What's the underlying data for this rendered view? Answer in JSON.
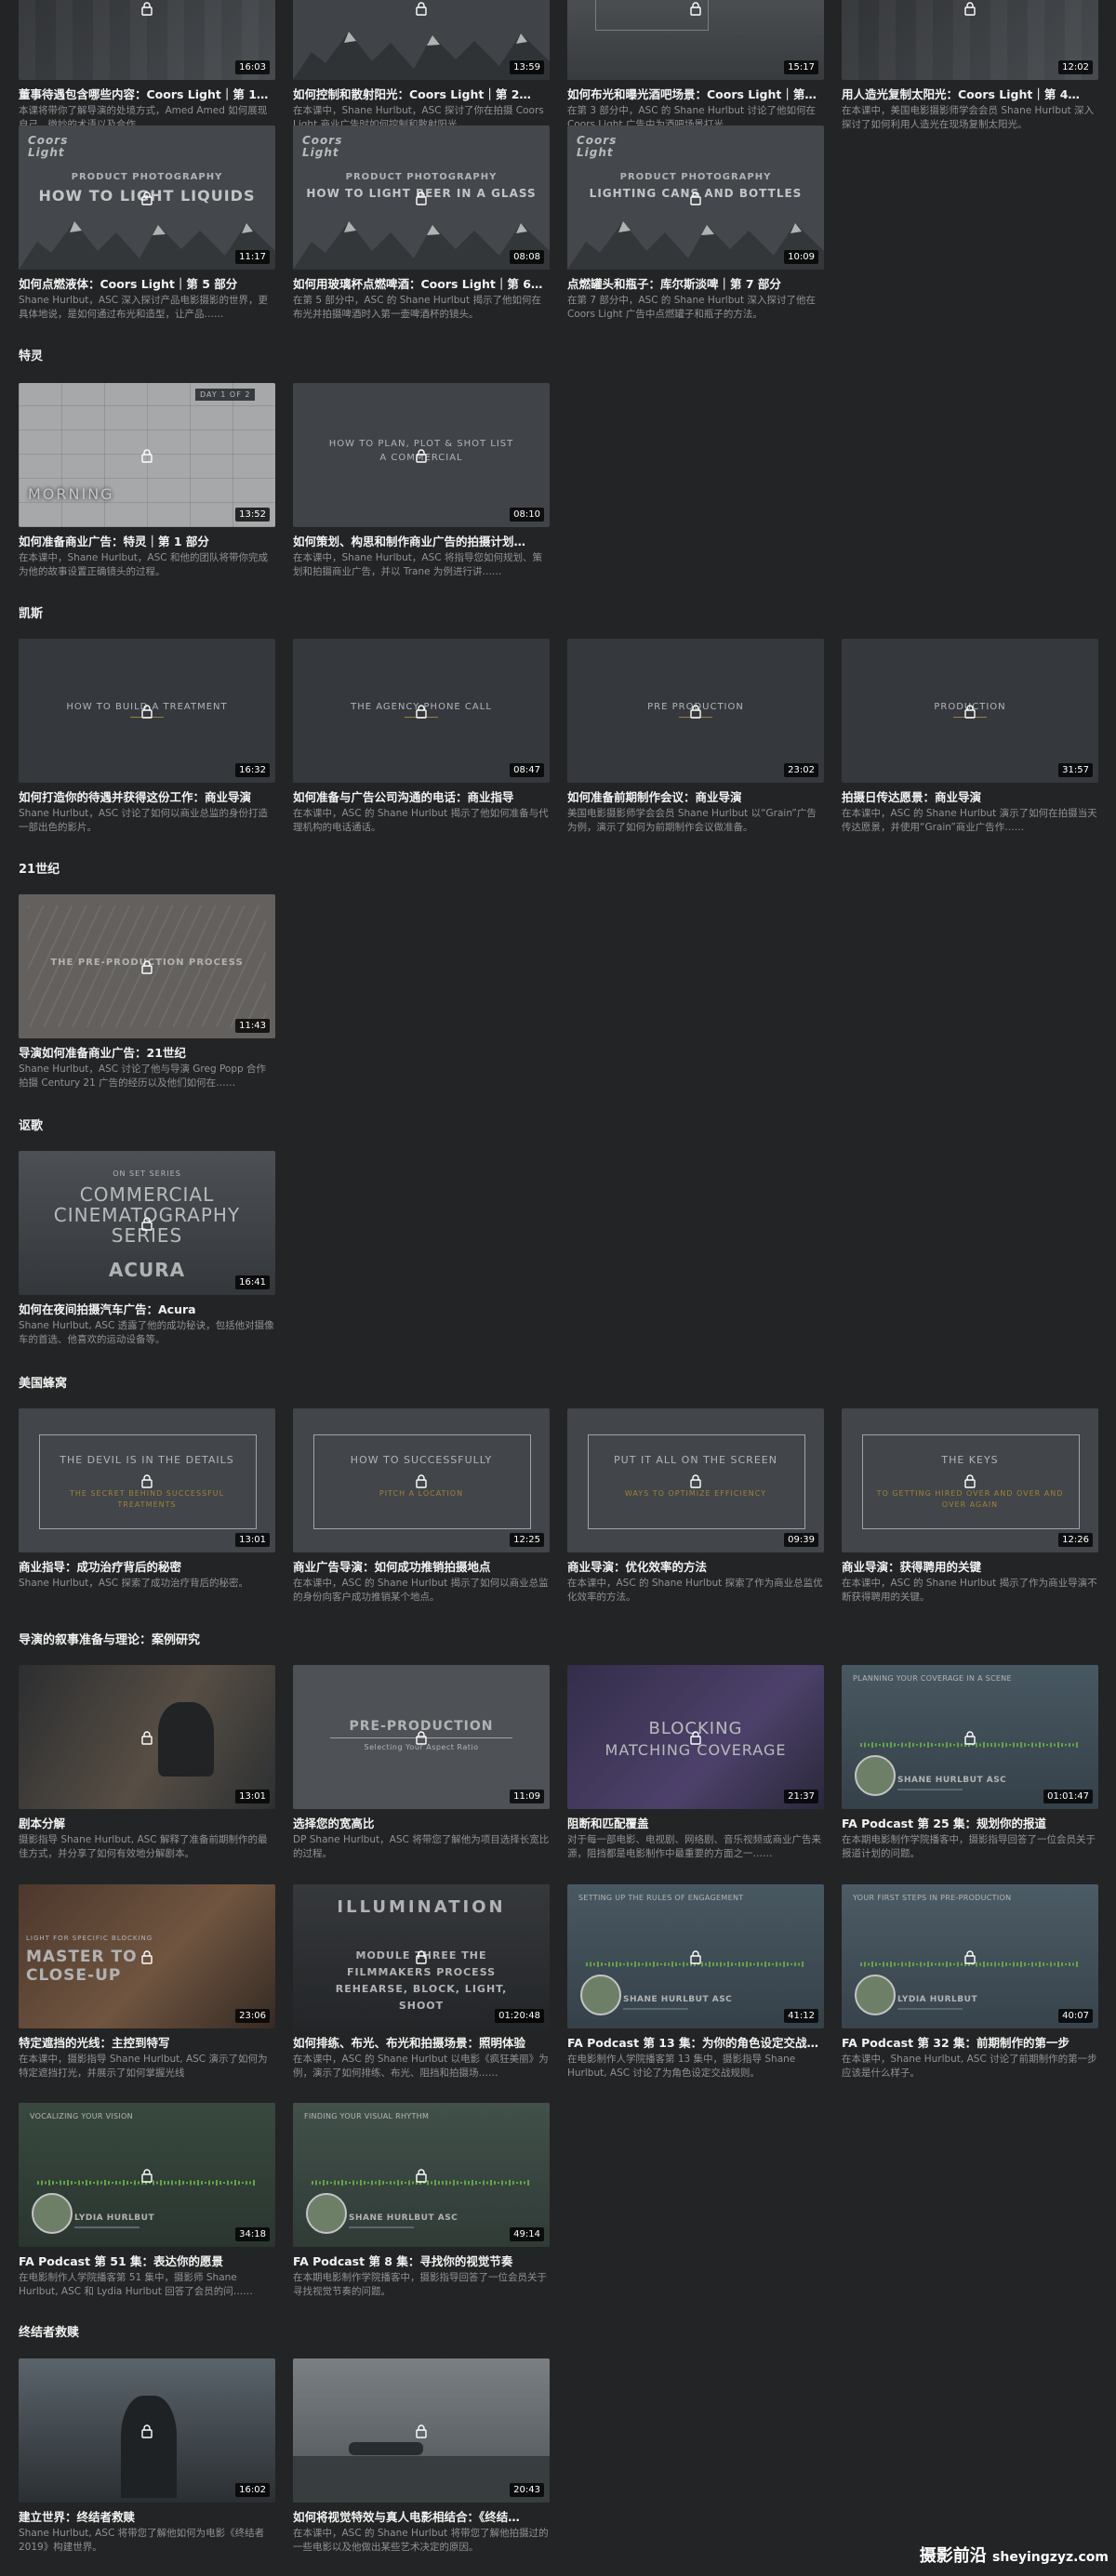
{
  "sections": [
    {
      "title": "",
      "cards": [
        {
          "title": "董事待遇包含哪些内容：Coors Light｜第 1…",
          "desc": "本课将带你了解导演的处境方式，Amed Amed 如何展现自己，微妙的术语以及合作……",
          "duration": "16:03",
          "theme": "dark"
        },
        {
          "title": "如何控制和散射阳光：Coors Light｜第 2…",
          "desc": "在本课中，Shane Hurlbut，ASC 探讨了你在拍摄 Coors Light 商业广告时如何控制和散射阳光。",
          "duration": "13:59",
          "theme": "mountain"
        },
        {
          "title": "如何布光和曝光酒吧场景：Coors Light｜第…",
          "desc": "在第 3 部分中，ASC 的 Shane Hurlbut 讨论了他如何在 Coors Light 广告中为酒吧场景打光。",
          "duration": "15:17",
          "theme": "grey"
        },
        {
          "title": "用人造光复制太阳光：Coors Light｜第 4…",
          "desc": "在本课中，美国电影摄影师学会会员 Shane Hurlbut 深入探讨了如何利用人造光在现场复制太阳光。",
          "duration": "12:02",
          "theme": "dark"
        }
      ]
    },
    {
      "title": "",
      "cards": [
        {
          "title": "如何点燃液体：Coors Light｜第 5 部分",
          "desc": "Shane Hurlbut，ASC 深入探讨产品电影摄影的世界，更具体地说，是如何通过布光和造型，让产品……",
          "duration": "11:17",
          "theme": "coors",
          "brand": "Coors Light",
          "head": "PRODUCT PHOTOGRAPHY",
          "sub": "HOW TO LIGHT LIQUIDS"
        },
        {
          "title": "如何用玻璃杯点燃啤酒：Coors Light｜第 6…",
          "desc": "在第 5 部分中，ASC 的 Shane Hurlbut 揭示了他如何在布光并拍摄啤酒时入第一壶啤酒杯的镜头。",
          "duration": "08:08",
          "theme": "coors",
          "brand": "Coors Light",
          "head": "PRODUCT PHOTOGRAPHY",
          "sub": "HOW TO LIGHT BEER IN A GLASS"
        },
        {
          "title": "点燃罐头和瓶子：库尔斯淡啤｜第 7 部分",
          "desc": "在第 7 部分中，ASC 的 Shane Hurlbut 深入探讨了他在 Coors Light 广告中点燃罐子和瓶子的方法。",
          "duration": "10:09",
          "theme": "coors",
          "brand": "Coors Light",
          "head": "PRODUCT PHOTOGRAPHY",
          "sub": "LIGHTING CANS AND BOTTLES"
        }
      ]
    },
    {
      "title": "特灵",
      "cards": [
        {
          "title": "如何准备商业广告：特灵｜第 1 部分",
          "desc": "在本课中，Shane Hurlbut，ASC 和他的团队将带你完成为他的故事设置正确镜头的过程。",
          "duration": "13:52",
          "theme": "storyboard",
          "head": "DAY 1 OF 2",
          "sub": "MORNING"
        },
        {
          "title": "如何策划、构思和制作商业广告的拍摄计划…",
          "desc": "在本课中，Shane Hurlbut，ASC 将指导您如何规划、策划和拍摄商业广告，并以 Trane 为例进行讲……",
          "duration": "08:10",
          "theme": "plan",
          "head": "HOW TO PLAN, PLOT & SHOT LIST",
          "sub": "A COMMERCIAL"
        }
      ]
    },
    {
      "title": "凯斯",
      "cards": [
        {
          "title": "如何打造你的待遇并获得这份工作：商业导演",
          "desc": "Shane Hurlbut，ASC 讨论了如何以商业总监的身份打造一部出色的影片。",
          "duration": "16:32",
          "theme": "plain",
          "head": "HOW TO BUILD A TREATMENT"
        },
        {
          "title": "如何准备与广告公司沟通的电话：商业指导",
          "desc": "在本课中，ASC 的 Shane Hurlbut 揭示了他如何准备与代理机构的电话通话。",
          "duration": "08:47",
          "theme": "plain",
          "head": "THE AGENCY PHONE CALL"
        },
        {
          "title": "如何准备前期制作会议：商业导演",
          "desc": "美国电影摄影师学会会员 Shane Hurlbut 以“Grain”广告为例，演示了如何为前期制作会议做准备。",
          "duration": "23:02",
          "theme": "plain",
          "head": "PRE PRODUCTION"
        },
        {
          "title": "拍摄日传达愿景：商业导演",
          "desc": "在本课中，ASC 的 Shane Hurlbut 演示了如何在拍摄当天传达愿景，并使用“Grain”商业广告作……",
          "duration": "31:57",
          "theme": "plain",
          "head": "PRODUCTION"
        }
      ]
    },
    {
      "title": "21世纪",
      "cards": [
        {
          "title": "导演如何准备商业广告：21世纪",
          "desc": "Shane Hurlbut，ASC 讨论了他与导演 Greg Popp 合作拍摄 Century 21 广告的经历以及他们如何在……",
          "duration": "11:43",
          "theme": "sketch",
          "head": "THE PRE-PRODUCTION PROCESS"
        }
      ]
    },
    {
      "title": "讴歌",
      "cards": [
        {
          "title": "如何在夜间拍摄汽车广告：Acura",
          "desc": "Shane Hurlbut, ASC 透露了他的成功秘诀，包括他对摄像车的首选、他喜欢的运动设备等。",
          "duration": "16:41",
          "theme": "acura",
          "head": "ON SET SERIES",
          "sub": "COMMERCIAL CINEMATOGRAPHY SERIES",
          "brand": "ACURA"
        }
      ]
    },
    {
      "title": "美国蜂窝",
      "cards": [
        {
          "title": "商业指导：成功治疗背后的秘密",
          "desc": "Shane Hurlbut，ASC 探索了成功治疗背后的秘密。",
          "duration": "13:01",
          "theme": "frame",
          "head": "THE DEVIL IS IN THE DETAILS",
          "sub": "THE SECRET BEHIND SUCCESSFUL TREATMENTS"
        },
        {
          "title": "商业广告导演：如何成功推销拍摄地点",
          "desc": "在本课中，ASC 的 Shane Hurlbut 揭示了如何以商业总监的身份向客户成功推销某个地点。",
          "duration": "12:25",
          "theme": "frame",
          "head": "HOW TO SUCCESSFULLY",
          "sub": "PITCH A LOCATION"
        },
        {
          "title": "商业导演：优化效率的方法",
          "desc": "在本课中，ASC 的 Shane Hurlbut 探索了作为商业总监优化效率的方法。",
          "duration": "09:39",
          "theme": "frame",
          "head": "PUT IT ALL ON THE SCREEN",
          "sub": "WAYS TO OPTIMIZE EFFICIENCY"
        },
        {
          "title": "商业导演：获得聘用的关键",
          "desc": "在本课中，ASC 的 Shane Hurlbut 揭示了作为商业导演不断获得聘用的关键。",
          "duration": "12:26",
          "theme": "frame",
          "head": "THE KEYS",
          "sub": "TO GETTING HIRED OVER AND OVER AND OVER AGAIN"
        }
      ]
    },
    {
      "title": "导演的叙事准备与理论：案例研究",
      "cards": [
        {
          "title": "剧本分解",
          "desc": "摄影指导 Shane Hurlbut, ASC 解释了准备前期制作的最佳方式，并分享了如何有效地分解剧本。",
          "duration": "13:01",
          "theme": "photo"
        },
        {
          "title": "选择您的宽高比",
          "desc": "DP Shane Hurlbut，ASC 将带您了解他为项目选择长宽比的过程。",
          "duration": "11:09",
          "theme": "preprod",
          "head": "PRE-PRODUCTION",
          "sub": "Selecting Your Aspect Ratio"
        },
        {
          "title": "阻断和匹配覆盖",
          "desc": "对于每一部电影、电视剧、网络剧、音乐视频或商业广告来源，阻挡都是电影制作中最重要的方面之一……",
          "duration": "21:37",
          "theme": "blocking",
          "head": "BLOCKING",
          "sub": "MATCHING COVERAGE"
        },
        {
          "title": "FA Podcast 第 25 集：规划你的报道",
          "desc": "在本期电影制作学院播客中，摄影指导回答了一位会员关于报道计划的问题。",
          "duration": "01:01:47",
          "theme": "podcast",
          "head": "PLANNING YOUR COVERAGE IN A SCENE",
          "sub": "SHANE HURLBUT ASC"
        }
      ]
    },
    {
      "title": "",
      "cards": [
        {
          "title": "特定遮挡的光线：主控到特写",
          "desc": "在本课中，摄影指导 Shane Hurlbut, ASC 演示了如何为特定遮挡打光，并展示了如何掌握光线",
          "duration": "23:06",
          "theme": "master",
          "head": "LIGHT FOR SPECIFIC BLOCKING",
          "sub": "MASTER TO CLOSE-UP"
        },
        {
          "title": "如何排练、布光、布光和拍摄场景：照明体验",
          "desc": "在本课中，ASC 的 Shane Hurlbut 以电影《疯狂美丽》为例，演示了如何排练、布光、阻挡和拍摄场……",
          "duration": "01:20:48",
          "theme": "illum",
          "head": "ILLUMINATION",
          "sub": "MODULE THREE THE FILMMAKERS PROCESS REHEARSE, BLOCK, LIGHT, SHOOT"
        },
        {
          "title": "FA Podcast 第 13 集：为你的角色设定交战…",
          "desc": "在电影制作人学院播客第 13 集中，摄影指导 Shane Hurlbut, ASC 讨论了为角色设定交战规则。",
          "duration": "41:12",
          "theme": "podcast",
          "head": "SETTING UP THE RULES OF ENGAGEMENT",
          "sub": "SHANE HURLBUT ASC"
        },
        {
          "title": "FA Podcast 第 32 集：前期制作的第一步",
          "desc": "在本课中，Shane Hurlbut, ASC 讨论了前期制作的第一步应该是什么样子。",
          "duration": "40:07",
          "theme": "podcast2",
          "head": "YOUR FIRST STEPS IN PRE-PRODUCTION",
          "sub": "LYDIA HURLBUT"
        }
      ]
    },
    {
      "title": "",
      "cards": [
        {
          "title": "FA Podcast 第 51 集：表达你的愿景",
          "desc": "在电影制作人学院播客第 51 集中，摄影师 Shane Hurlbut, ASC 和 Lydia Hurlbut 回答了会员的问……",
          "duration": "34:18",
          "theme": "podcastG",
          "head": "VOCALIZING YOUR VISION",
          "sub": "LYDIA HURLBUT"
        },
        {
          "title": "FA Podcast 第 8 集：寻找你的视觉节奏",
          "desc": "在本期电影制作学院播客中，摄影指导回答了一位会员关于寻找视觉节奏的问题。",
          "duration": "49:14",
          "theme": "podcastG2",
          "head": "FINDING YOUR VISUAL RHYTHM",
          "sub": "SHANE HURLBUT ASC"
        }
      ]
    },
    {
      "title": "终结者救赎",
      "cards": [
        {
          "title": "建立世界：终结者救赎",
          "desc": "Shane Hurlbut, ASC 将带您了解他如何为电影《终结者 2019》构建世界。",
          "duration": "16:02",
          "theme": "term"
        },
        {
          "title": "如何将视觉特效与真人电影相结合：《终结…",
          "desc": "在本课中，ASC 的 Shane Hurlbut 将带您了解他拍摄过的一些电影以及他做出某些艺术决定的原因。",
          "duration": "20:43",
          "theme": "heli"
        }
      ]
    }
  ],
  "watermark": {
    "cn": "摄影前沿",
    "site": "sheyingzyz.com"
  }
}
